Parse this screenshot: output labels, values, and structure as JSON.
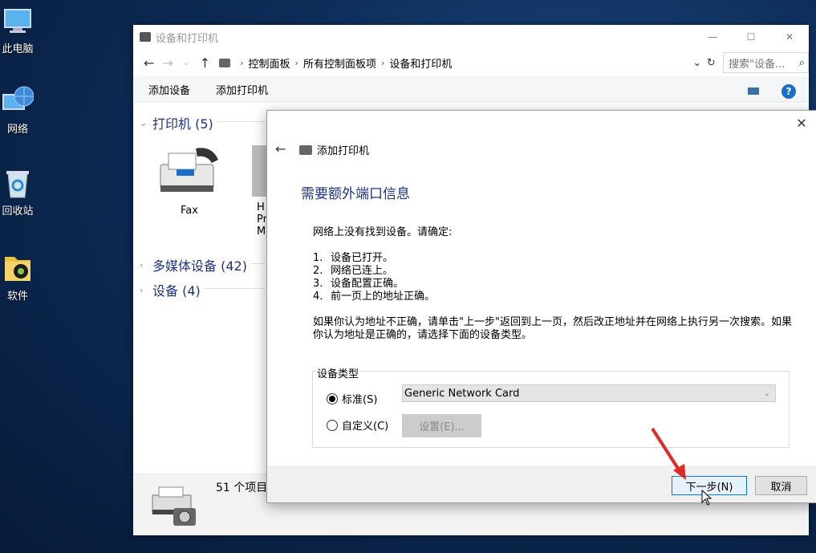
{
  "desktop": {
    "icons": [
      {
        "label": "此电脑",
        "icon": "computer-icon"
      },
      {
        "label": "网络",
        "icon": "network-icon"
      },
      {
        "label": "回收站",
        "icon": "recycle-bin-icon"
      },
      {
        "label": "软件",
        "icon": "folder-icon"
      }
    ]
  },
  "explorer": {
    "title": "设备和打印机",
    "breadcrumb": [
      "控制面板",
      "所有控制面板项",
      "设备和打印机"
    ],
    "search_placeholder": "搜索\"设备...",
    "commands": [
      "添加设备",
      "添加打印机"
    ],
    "help": "?",
    "groups": [
      {
        "label": "打印机 (5)",
        "expanded": true
      },
      {
        "label": "多媒体设备 (42)",
        "expanded": false
      },
      {
        "label": "设备 (4)",
        "expanded": false
      }
    ],
    "printers": [
      {
        "name": "Fax"
      },
      {
        "name": "H"
      }
    ],
    "partial_label_lines": [
      "Pr",
      "M"
    ],
    "status_count": "51 个项目"
  },
  "dialog": {
    "title": "添加打印机",
    "heading": "需要额外端口信息",
    "intro": "网络上没有找到设备。请确定:",
    "checks": [
      {
        "num": "1.",
        "text": "设备已打开。"
      },
      {
        "num": "2.",
        "text": "网络已连上。"
      },
      {
        "num": "3.",
        "text": "设备配置正确。"
      },
      {
        "num": "4.",
        "text": "前一页上的地址正确。"
      }
    ],
    "paragraph_line1": "如果你认为地址不正确，请单击\"上一步\"返回到上一页，然后改正地址并在网络上执行另一次搜索。如果",
    "paragraph_line2": "你认为地址是正确的，请选择下面的设备类型。",
    "device_type_label": "设备类型",
    "standard_label": "标准(S)",
    "custom_label": "自定义(C)",
    "standard_selected": true,
    "standard_value": "Generic Network Card",
    "settings_button": "设置(E)...",
    "next_button": "下一步(N)",
    "cancel_button": "取消"
  },
  "colors": {
    "accent": "#1e3287",
    "annotation_arrow": "#e02a2a",
    "help": "#1a6fc9"
  }
}
